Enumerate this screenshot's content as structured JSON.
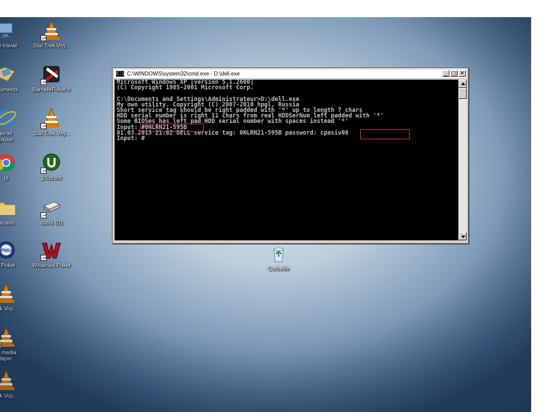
{
  "desktop": {
    "icons": [
      {
        "name": "poste-de-travail",
        "label": "de travail"
      },
      {
        "name": "star-trek-voy-1",
        "label": "Star.Trek.Voy..."
      },
      {
        "name": "documents",
        "label": "ocuments"
      },
      {
        "name": "barrierepoker",
        "label": "BarrierePoker.fr"
      },
      {
        "name": "internet-explorer",
        "label": "ernet\nplorer"
      },
      {
        "name": "star-trek-voy-2",
        "label": "Star.Trek.Voy..."
      },
      {
        "name": "chrome",
        "label": "(é"
      },
      {
        "name": "utorrent",
        "label": "µTorrent"
      },
      {
        "name": "downloads",
        "label": "nloads"
      },
      {
        "name": "outils",
        "label": "outils (D)"
      },
      {
        "name": "pmu-poker",
        "label": "J Poker"
      },
      {
        "name": "winamax-poker",
        "label": "Winamax Poker"
      },
      {
        "name": "corbeille",
        "label": "Corbeille"
      },
      {
        "name": "star-trek-voy-3",
        "label": "rek.Voy..."
      },
      {
        "name": "vlc-media-player",
        "label": "C media\nlayer"
      },
      {
        "name": "star-trek-voy-4",
        "label": "rek.Voy..."
      }
    ]
  },
  "cmd": {
    "title": "C:\\WINDOWS\\system32\\cmd.exe - D:\\dell.exe",
    "icon_text": "C:\\",
    "buttons": {
      "minimize": "_",
      "maximize": "□",
      "close": "✕"
    },
    "lines": [
      "Microsoft Windows XP [version 5.1.2600]",
      "(C) Copyright 1985-2001 Microsoft Corp.",
      "",
      "C:\\Documents and Settings\\Administrateur>D:\\dell.exe",
      "My own utility. Copyright (C) 2007-2010 hpgl, Russia",
      "Short service tag should be right padded with '*' up to length 7 chars",
      "HDD serial number is right 11 chars from real HDDSerNum left padded with '*'",
      "Some BIOSes has left pad HDD serial number with spaces instead '*'",
      "Input: #0NLRN21-595B",
      "01.03.2013 21:02 DELL service tag: 0NLRN21-595B password: cpasiv08",
      "Input: #"
    ]
  },
  "colors": {
    "console_bg": "#000000",
    "console_text": "#c0c0c0",
    "highlight_box": "#c0304a"
  }
}
